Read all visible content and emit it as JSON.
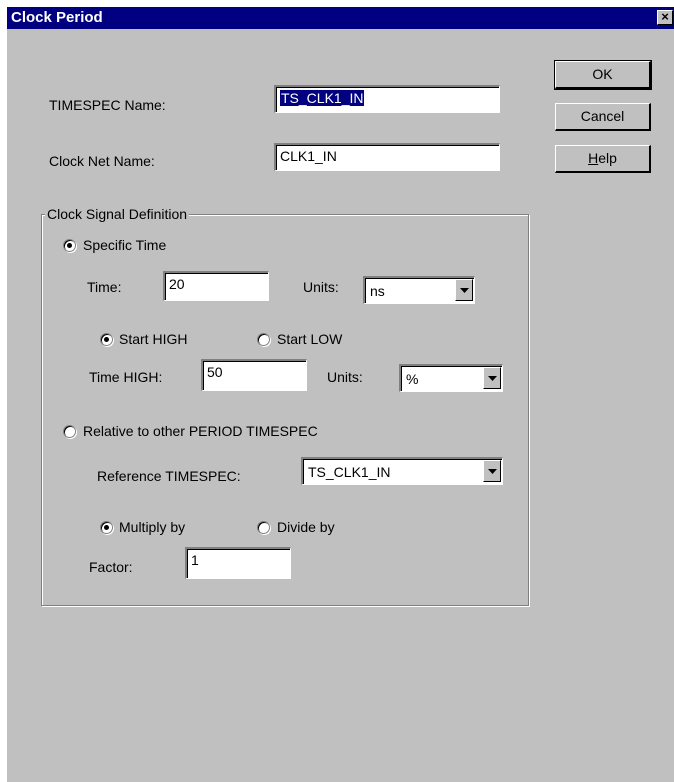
{
  "window": {
    "title": "Clock Period",
    "close_glyph": "×"
  },
  "fields": {
    "timespec_name_label": "TIMESPEC Name:",
    "timespec_name_value": "TS_CLK1_IN",
    "clock_net_label": "Clock Net Name:",
    "clock_net_value": "CLK1_IN"
  },
  "buttons": {
    "ok": "OK",
    "cancel": "Cancel",
    "help_h": "H",
    "help_rest": "elp"
  },
  "group": {
    "title": "Clock Signal Definition",
    "specific_time": {
      "label": "Specific Time",
      "selected": true,
      "time_label": "Time:",
      "time_value": "20",
      "units_label": "Units:",
      "units_value": "ns",
      "start_high_label": "Start HIGH",
      "start_high_selected": true,
      "start_low_label": "Start LOW",
      "time_high_label": "Time HIGH:",
      "time_high_value": "50",
      "units2_label": "Units:",
      "units2_value": "%"
    },
    "relative": {
      "label": "Relative to other PERIOD TIMESPEC",
      "selected": false,
      "ref_label": "Reference TIMESPEC:",
      "ref_value": "TS_CLK1_IN",
      "multiply_label": "Multiply by",
      "multiply_selected": true,
      "divide_label": "Divide by",
      "factor_label": "Factor:",
      "factor_value": "1"
    }
  },
  "icons": {
    "close": "close-icon",
    "dropdown": "chevron-down-icon",
    "radio": "radio-icon"
  }
}
